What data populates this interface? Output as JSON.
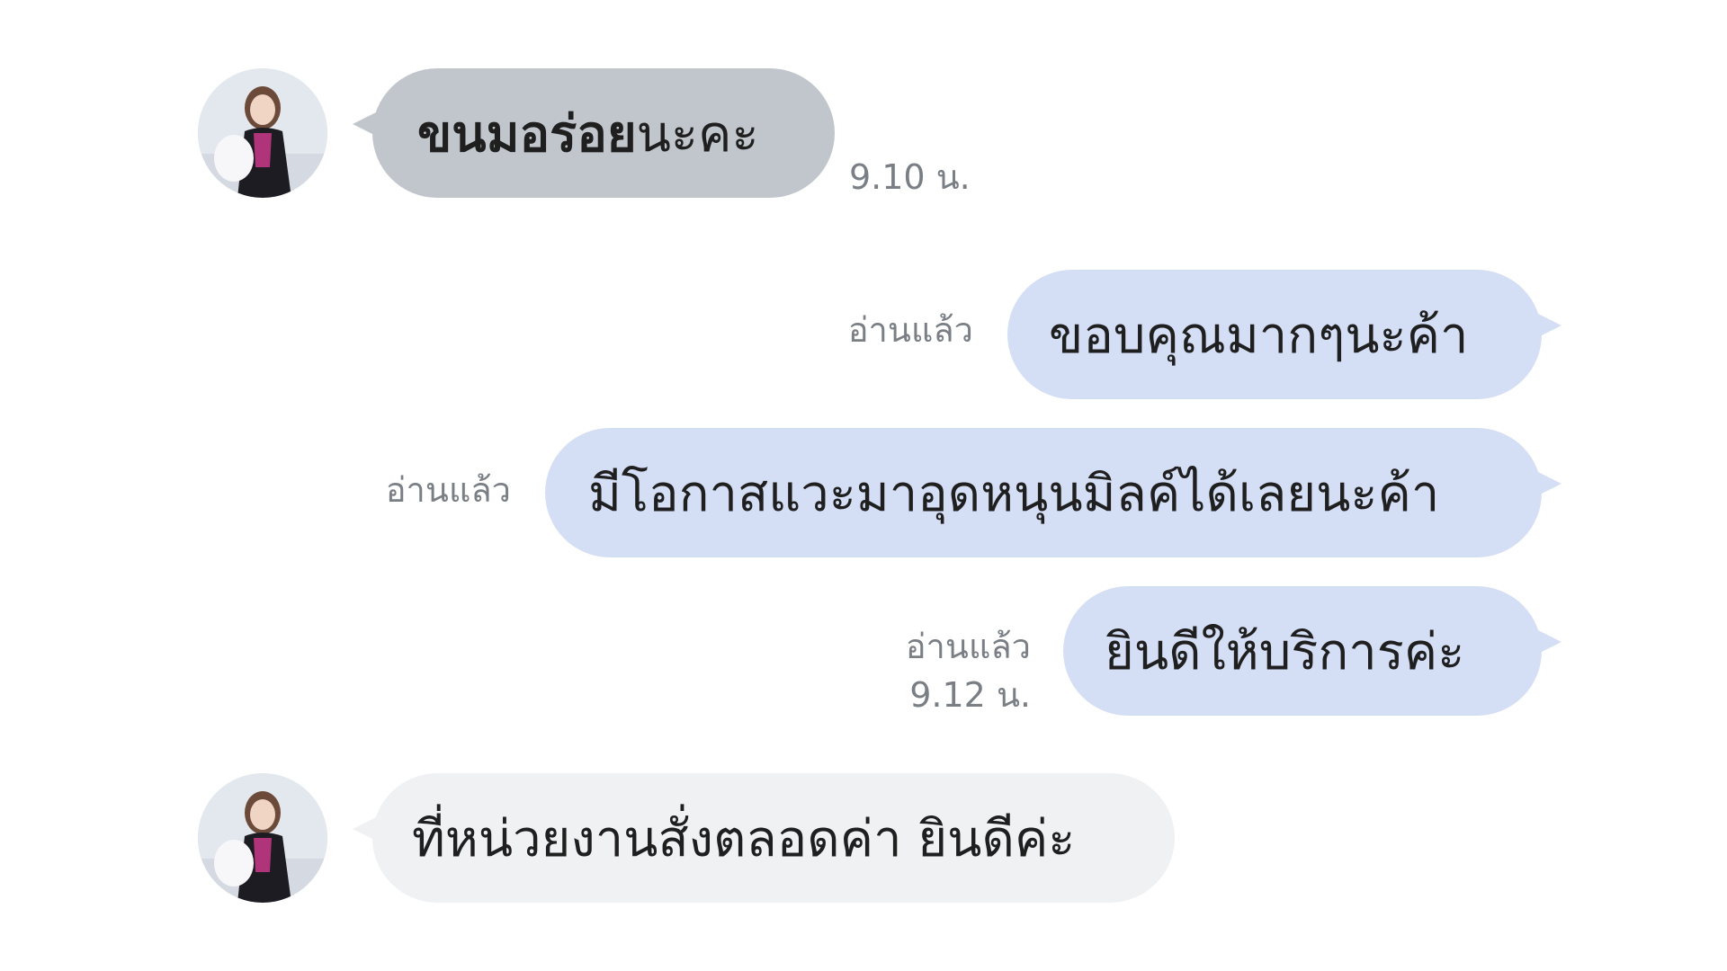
{
  "messages": [
    {
      "direction": "incoming",
      "bold_part": "ขนมอร่อย",
      "rest_part": "นะคะ",
      "time": "9.10 น."
    },
    {
      "direction": "outgoing",
      "text": "ขอบคุณมากๆนะค้า",
      "read_status": "อ่านแล้ว"
    },
    {
      "direction": "outgoing",
      "text": "มีโอกาสแวะมาอุดหนุนมิลค์ได้เลยนะค้า",
      "read_status": "อ่านแล้ว"
    },
    {
      "direction": "outgoing",
      "text": "ยินดีให้บริการค่ะ",
      "read_status": "อ่านแล้ว",
      "time": "9.12 น."
    },
    {
      "direction": "incoming",
      "text": "ที่หน่วยงานสั่งตลอดค่า ยินดีค่ะ"
    }
  ],
  "colors": {
    "incoming_bubble_first": "#c1c6cc",
    "incoming_bubble": "#f0f1f3",
    "outgoing_bubble": "#d4def5",
    "meta_text": "#7a7f86",
    "message_text": "#1f1f1f"
  },
  "icons": {
    "avatar": "user-avatar-photo"
  }
}
